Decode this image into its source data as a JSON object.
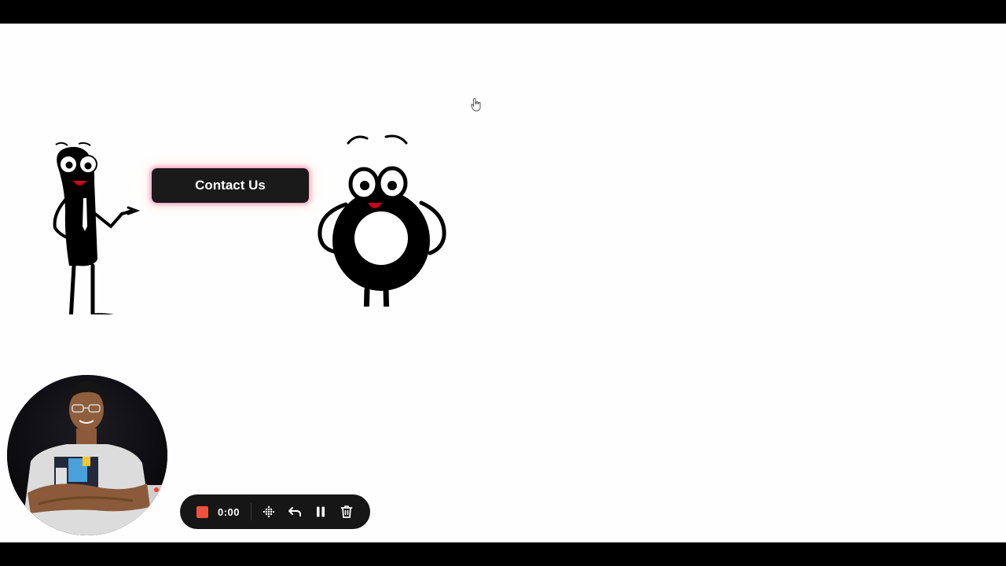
{
  "contact_button": {
    "label": "Contact Us"
  },
  "recorder": {
    "timer": "0:00",
    "controls": {
      "stop": "stop-icon",
      "grid": "grid-dots-icon",
      "restart": "undo-icon",
      "pause": "pause-icon",
      "delete": "trash-icon"
    }
  },
  "colors": {
    "button_bg": "#1a1a1a",
    "button_glow": "#ff78be",
    "stop_red": "#f0513c",
    "toolbar_bg": "#161616",
    "stage_bg": "#fefefe",
    "mouth_red": "#c8001e"
  },
  "icons": {
    "cursor": "hand-pointer-icon"
  }
}
